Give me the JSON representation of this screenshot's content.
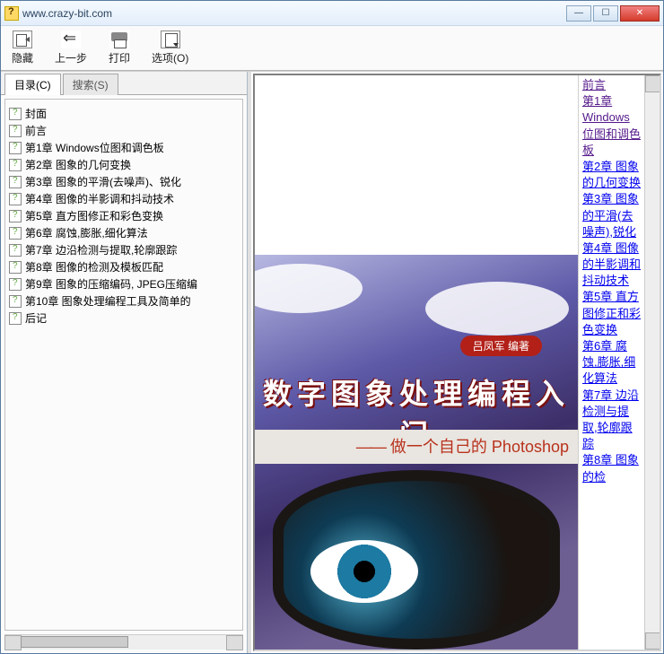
{
  "title": "www.crazy-bit.com",
  "toolbar": {
    "hide": "隐藏",
    "back": "上一步",
    "print": "打印",
    "options": "选项(O)"
  },
  "tabs": {
    "contents": "目录(C)",
    "search": "搜索(S)"
  },
  "toc": [
    "封面",
    "前言",
    "第1章  Windows位图和调色板",
    "第2章  图象的几何变换",
    "第3章  图象的平滑(去噪声)、锐化",
    "第4章  图像的半影调和抖动技术",
    "第5章  直方图修正和彩色变换",
    "第6章  腐蚀,膨胀,细化算法",
    "第7章  边沿检测与提取,轮廓跟踪",
    "第8章  图像的检测及模板匹配",
    "第9章  图象的压缩编码, JPEG压缩编",
    "第10章  图象处理编程工具及简单的",
    "后记"
  ],
  "cover": {
    "author": "吕凤军  编著",
    "title": "数字图象处理编程入门",
    "subtitle_prefix": "——",
    "subtitle": "做一个自己的 Photoshop"
  },
  "rightnav": [
    {
      "text": "前言",
      "visited": true
    },
    {
      "text": "第1章",
      "visited": true
    },
    {
      "text": "Windows位图和调色板",
      "visited": true
    },
    {
      "text": "第2章 图象的几何变换",
      "visited": false
    },
    {
      "text": "第3章 图象的平滑(去噪声),锐化",
      "visited": false
    },
    {
      "text": "第4章 图像的半影调和抖动技术",
      "visited": false
    },
    {
      "text": "第5章 直方图修正和彩色变换",
      "visited": false
    },
    {
      "text": "第6章 腐蚀,膨胀,细化算法",
      "visited": false
    },
    {
      "text": "第7章 边沿检测与提取,轮廓跟踪",
      "visited": false
    },
    {
      "text": "第8章 图象的检",
      "visited": false
    }
  ]
}
